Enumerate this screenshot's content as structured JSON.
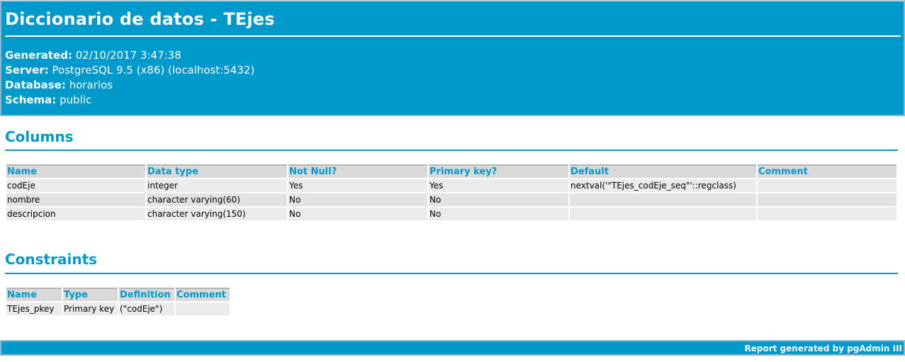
{
  "header": {
    "title": "Diccionario de datos - TEjes",
    "generated_label": "Generated:",
    "generated_value": "02/10/2017 3:47:38",
    "server_label": "Server:",
    "server_value": "PostgreSQL 9.5 (x86) (localhost:5432)",
    "database_label": "Database:",
    "database_value": "horarios",
    "schema_label": "Schema:",
    "schema_value": "public"
  },
  "columns": {
    "title": "Columns",
    "headers": [
      "Name",
      "Data type",
      "Not Null?",
      "Primary key?",
      "Default",
      "Comment"
    ],
    "rows": [
      [
        "codEje",
        "integer",
        "Yes",
        "Yes",
        "nextval('\"TEjes_codEje_seq\"'::regclass)",
        ""
      ],
      [
        "nombre",
        "character varying(60)",
        "No",
        "No",
        "",
        ""
      ],
      [
        "descripcion",
        "character varying(150)",
        "No",
        "No",
        "",
        ""
      ]
    ]
  },
  "constraints": {
    "title": "Constraints",
    "headers": [
      "Name",
      "Type",
      "Definition",
      "Comment"
    ],
    "rows": [
      [
        "TEjes_pkey",
        "Primary key",
        "(\"codEje\")",
        ""
      ]
    ]
  },
  "footer": {
    "text": "Report generated by pgAdmin III"
  }
}
